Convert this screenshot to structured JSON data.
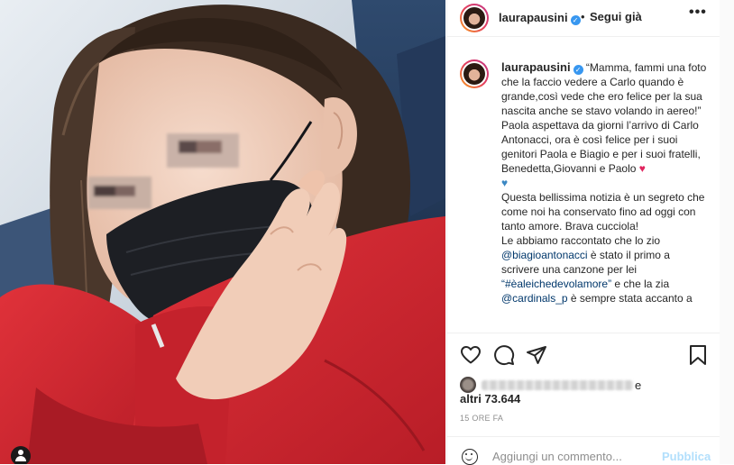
{
  "post": {
    "username": "laurapausini",
    "follow_separator": "•",
    "follow_status": "Segui già",
    "more_label": "•••"
  },
  "caption": {
    "username": "laurapausini",
    "lines": [
      "“Mamma, fammi una foto che la faccio vedere a Carlo quando è grande,così vede che ero felice per la sua nascita anche se stavo volando in aereo!”",
      "Paola aspettava da giorni l’arrivo di Carlo Antonacci, ora è così felice per i suoi genitori Paola e Biagio e per i suoi fratelli, Benedetta,Giovanni e Paolo",
      "Questa bellissima notizia è un segreto che come noi ha conservato fino ad oggi con tanto amore. Brava cucciola!",
      "Le abbiamo raccontato che lo zio",
      "è stato il primo a scrivere una canzone per lei",
      "e che la zia",
      "è sempre stata accanto a"
    ],
    "mention_biagio": "@biagioantonacci",
    "hashtag": "“#èaleichedevolamore”",
    "mention_cardinals": "@cardinals_p",
    "heart_red": "♥",
    "heart_blue": "♥"
  },
  "actions": {
    "like_icon": "heart-outline-icon",
    "comment_icon": "comment-icon",
    "share_icon": "share-icon",
    "save_icon": "bookmark-icon"
  },
  "likes": {
    "conjunction": "e",
    "count_text": "altri 73.644"
  },
  "timestamp": "15 ORE FA",
  "comment": {
    "placeholder": "Aggiungi un commento...",
    "publish_label": "Pubblica"
  },
  "colors": {
    "accent": "#0095f6",
    "publish_disabled": "#b2dffc",
    "verified": "#3897f0",
    "photo_sweater": "#d42a30"
  }
}
